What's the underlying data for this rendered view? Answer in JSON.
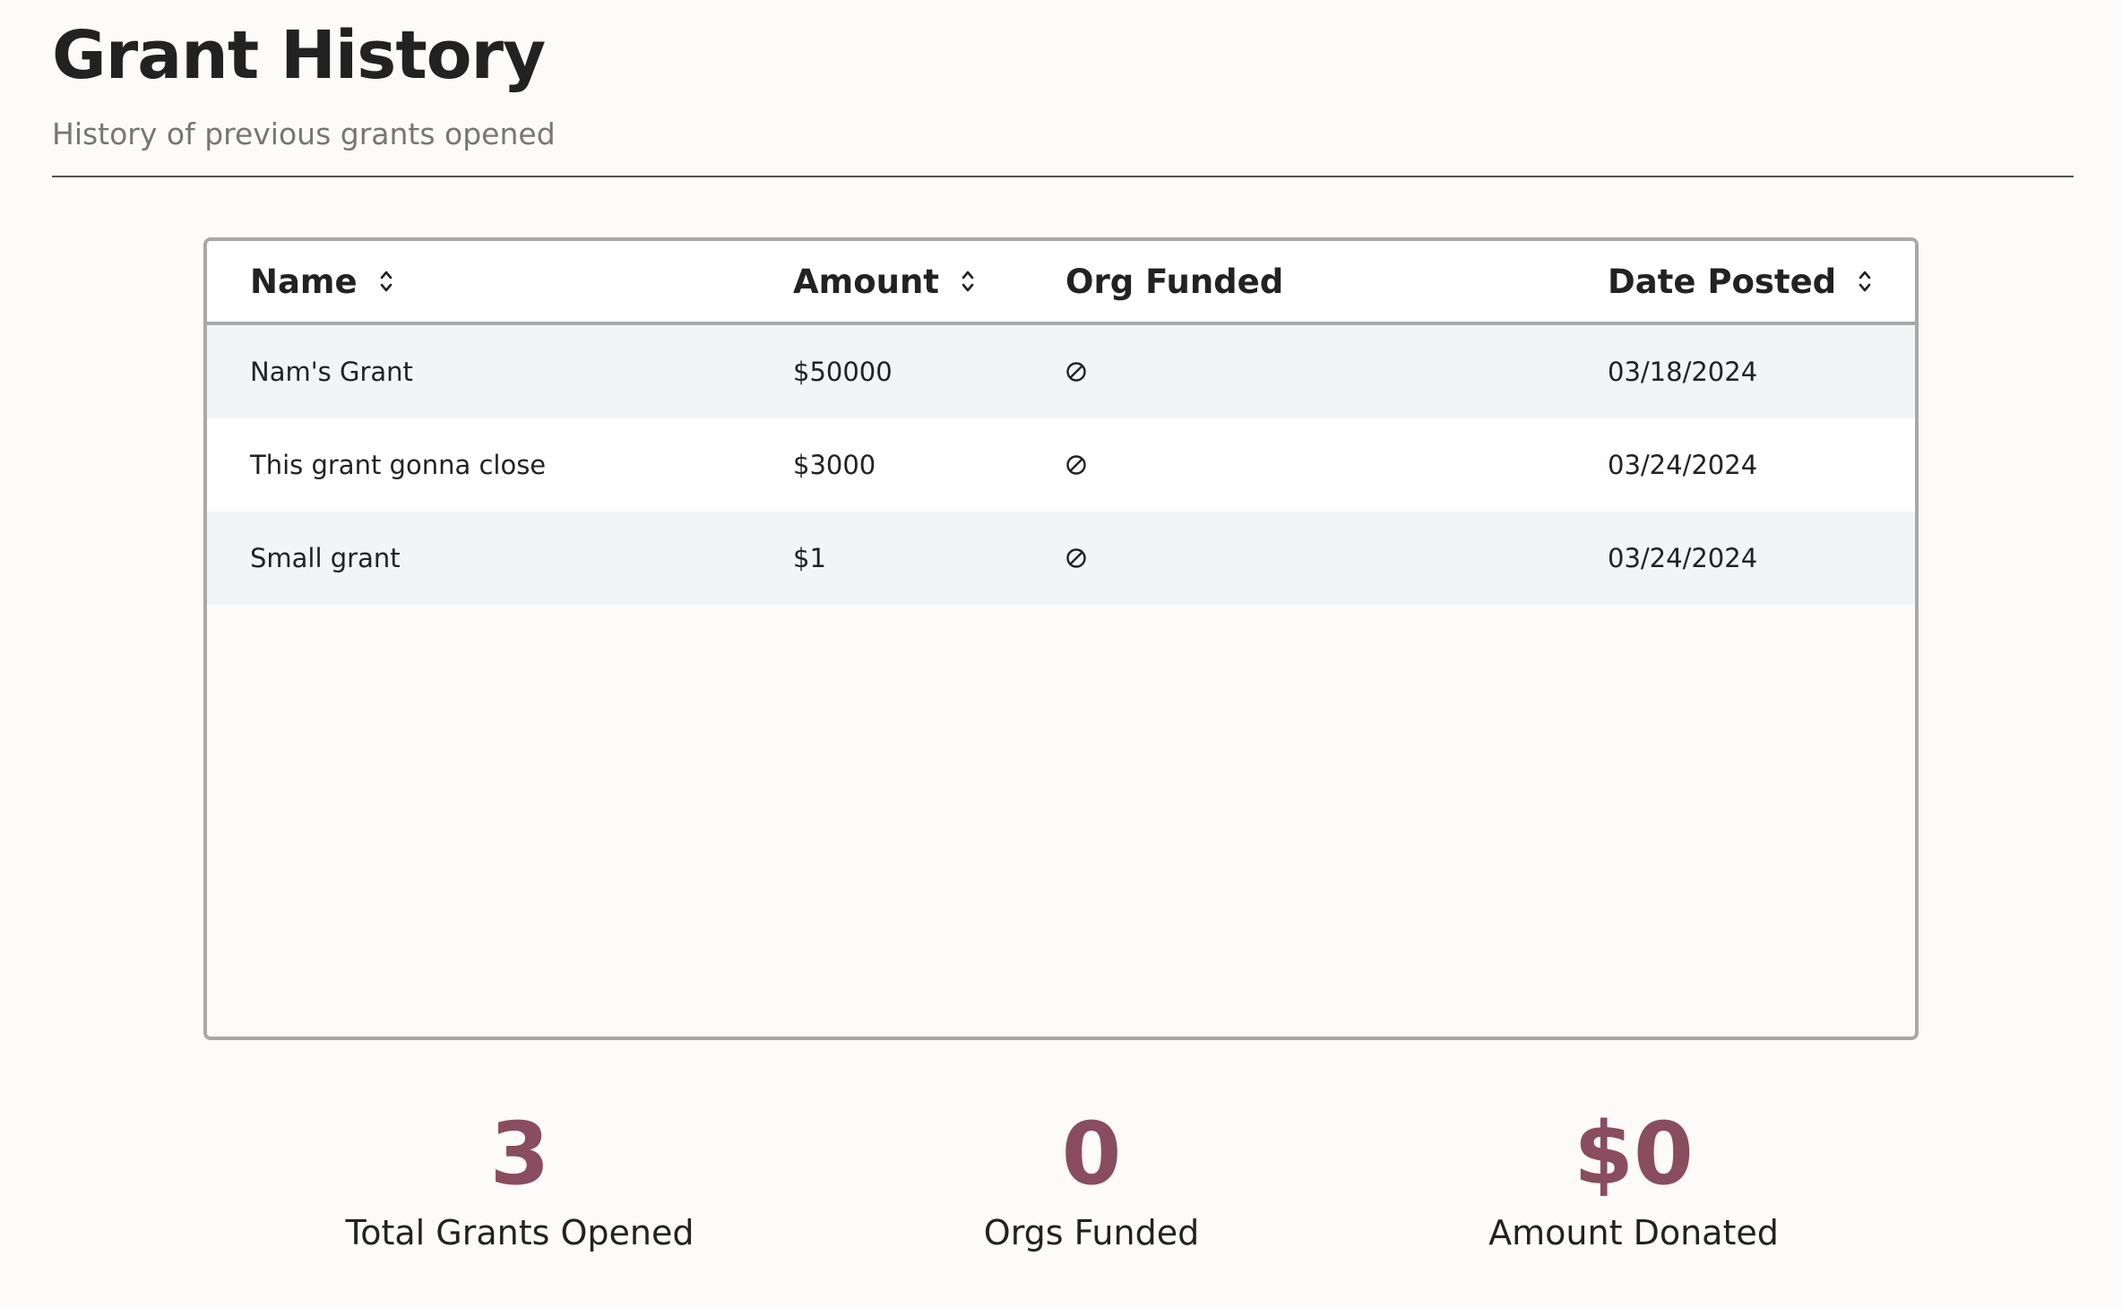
{
  "header": {
    "title": "Grant History",
    "subtitle": "History of previous grants opened"
  },
  "table": {
    "columns": [
      {
        "label": "Name",
        "sortable": true
      },
      {
        "label": "Amount",
        "sortable": true
      },
      {
        "label": "Org Funded",
        "sortable": false
      },
      {
        "label": "Date Posted",
        "sortable": true
      }
    ],
    "rows": [
      {
        "name": "Nam's Grant",
        "amount": "$50000",
        "org_funded_icon": "null-icon",
        "date": "03/18/2024"
      },
      {
        "name": "This grant gonna close",
        "amount": "$3000",
        "org_funded_icon": "null-icon",
        "date": "03/24/2024"
      },
      {
        "name": "Small grant",
        "amount": "$1",
        "org_funded_icon": "null-icon",
        "date": "03/24/2024"
      }
    ]
  },
  "stats": [
    {
      "value": "3",
      "label": "Total Grants Opened"
    },
    {
      "value": "0",
      "label": "Orgs Funded"
    },
    {
      "value": "$0",
      "label": "Amount Donated"
    }
  ],
  "colors": {
    "accent": "#8a4c60",
    "row_alt": "#f3f4f6",
    "border": "#a8a8a8",
    "subtitle": "#767676"
  }
}
